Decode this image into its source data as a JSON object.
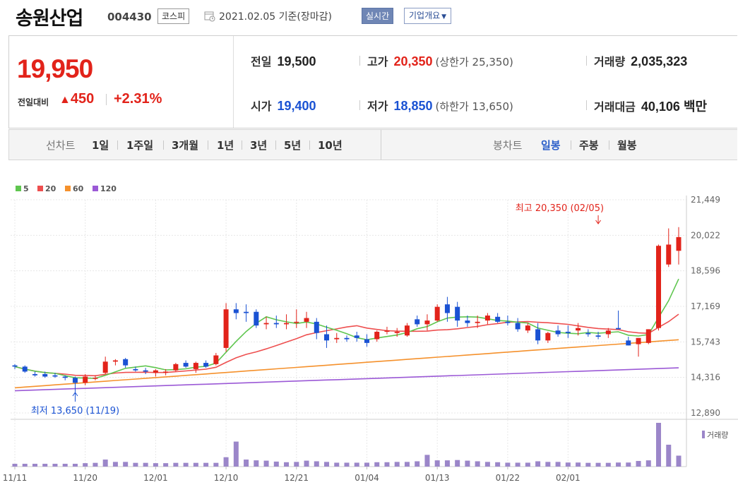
{
  "header": {
    "company": "송원산업",
    "code": "004430",
    "market": "코스피",
    "date": "2021.02.05 기준(장마감)",
    "realtime_btn": "실시간",
    "overview_btn": "기업개요"
  },
  "price": {
    "current": "19,950",
    "change_label": "전일대비",
    "change": "450",
    "change_pct": "+2.31%"
  },
  "stats": {
    "prev_label": "전일",
    "prev": "19,500",
    "open_label": "시가",
    "open": "19,400",
    "high_label": "고가",
    "high": "20,350",
    "upper_limit": "(상한가 25,350)",
    "low_label": "저가",
    "low": "18,850",
    "lower_limit": "(하한가 13,650)",
    "volume_label": "거래량",
    "volume": "2,035,323",
    "amount_label": "거래대금",
    "amount": "40,106 백만"
  },
  "periods": {
    "line_label": "선차트",
    "line": [
      "1일",
      "1주일",
      "3개월",
      "1년",
      "3년",
      "5년",
      "10년"
    ],
    "candle_label": "봉차트",
    "candle": [
      "일봉",
      "주봉",
      "월봉"
    ],
    "candle_selected": "일봉"
  },
  "colors": {
    "up": "#e2231a",
    "down": "#1a52d3",
    "ma5": "#5fc64f",
    "ma20": "#ee4f4f",
    "ma60": "#f5912c",
    "ma120": "#9b59d6",
    "volume": "#9b86c9"
  },
  "chart_data": {
    "type": "candlestick",
    "legend": [
      {
        "name": "5",
        "color": "#5fc64f"
      },
      {
        "name": "20",
        "color": "#ee4f4f"
      },
      {
        "name": "60",
        "color": "#f5912c"
      },
      {
        "name": "120",
        "color": "#9b59d6"
      }
    ],
    "y_ticks": [
      "21,449",
      "20,022",
      "18,596",
      "17,169",
      "15,743",
      "14,316",
      "12,890"
    ],
    "ylim": [
      12890,
      21449
    ],
    "x_ticks": [
      {
        "i": 0,
        "label": "11/11"
      },
      {
        "i": 7,
        "label": "11/20"
      },
      {
        "i": 14,
        "label": "12/01"
      },
      {
        "i": 21,
        "label": "12/10"
      },
      {
        "i": 28,
        "label": "12/21"
      },
      {
        "i": 35,
        "label": "01/04"
      },
      {
        "i": 42,
        "label": "01/13"
      },
      {
        "i": 49,
        "label": "01/22"
      },
      {
        "i": 55,
        "label": "02/01"
      }
    ],
    "annotations": {
      "high": {
        "i": 58,
        "text": "최고 20,350 (02/05)"
      },
      "low": {
        "i": 6,
        "text": "최저 13,650 (11/19)"
      }
    },
    "volume_label": "거래량",
    "ohlc": [
      [
        14800,
        14850,
        14650,
        14750
      ],
      [
        14750,
        14800,
        14500,
        14550
      ],
      [
        14450,
        14550,
        14350,
        14400
      ],
      [
        14450,
        14550,
        14300,
        14350
      ],
      [
        14400,
        14500,
        14300,
        14350
      ],
      [
        14350,
        14400,
        14200,
        14300
      ],
      [
        14300,
        14350,
        13650,
        14100
      ],
      [
        14100,
        14450,
        14000,
        14350
      ],
      [
        14300,
        14400,
        14200,
        14300
      ],
      [
        14500,
        15150,
        14450,
        14950
      ],
      [
        14950,
        15050,
        14800,
        15000
      ],
      [
        15050,
        15100,
        14700,
        14800
      ],
      [
        14650,
        14750,
        14550,
        14600
      ],
      [
        14600,
        14700,
        14450,
        14550
      ],
      [
        14500,
        14650,
        14350,
        14600
      ],
      [
        14550,
        14650,
        14400,
        14550
      ],
      [
        14600,
        14900,
        14550,
        14850
      ],
      [
        14900,
        15000,
        14700,
        14750
      ],
      [
        14650,
        14950,
        14500,
        14900
      ],
      [
        14900,
        15000,
        14700,
        14750
      ],
      [
        14850,
        15300,
        14800,
        15200
      ],
      [
        15500,
        17300,
        15350,
        17050
      ],
      [
        17050,
        17300,
        16650,
        16900
      ],
      [
        16950,
        17250,
        16550,
        16900
      ],
      [
        16950,
        17050,
        16300,
        16400
      ],
      [
        16450,
        16750,
        16250,
        16500
      ],
      [
        16500,
        16800,
        16300,
        16450
      ],
      [
        16450,
        16850,
        16250,
        16500
      ],
      [
        16550,
        17050,
        16300,
        16550
      ],
      [
        16550,
        16950,
        16300,
        16700
      ],
      [
        16550,
        16700,
        15850,
        16100
      ],
      [
        16050,
        16400,
        15500,
        15800
      ],
      [
        15850,
        16100,
        15700,
        15900
      ],
      [
        15900,
        16000,
        15750,
        15850
      ],
      [
        16000,
        16150,
        15750,
        15900
      ],
      [
        15850,
        16050,
        15550,
        15700
      ],
      [
        15850,
        16200,
        15750,
        16150
      ],
      [
        16150,
        16350,
        16050,
        16200
      ],
      [
        16100,
        16300,
        15950,
        16150
      ],
      [
        16000,
        16500,
        15950,
        16400
      ],
      [
        16650,
        16800,
        16350,
        16450
      ],
      [
        16450,
        16850,
        16200,
        16600
      ],
      [
        16600,
        17250,
        16550,
        17150
      ],
      [
        17250,
        17550,
        16550,
        16900
      ],
      [
        17150,
        17350,
        16350,
        16600
      ],
      [
        16600,
        16800,
        16350,
        16500
      ],
      [
        16500,
        16800,
        16300,
        16550
      ],
      [
        16600,
        16900,
        16450,
        16800
      ],
      [
        16750,
        16900,
        16500,
        16550
      ],
      [
        16550,
        16800,
        16400,
        16500
      ],
      [
        16500,
        16700,
        16150,
        16250
      ],
      [
        16200,
        16500,
        16100,
        16400
      ],
      [
        16250,
        16500,
        15650,
        15800
      ],
      [
        15800,
        16150,
        15700,
        16100
      ],
      [
        16200,
        16400,
        15950,
        16050
      ],
      [
        16150,
        16400,
        15900,
        16100
      ],
      [
        16200,
        16500,
        16000,
        16300
      ],
      [
        16100,
        16250,
        15950,
        16050
      ],
      [
        16000,
        16150,
        15850,
        15950
      ],
      [
        16050,
        16300,
        15900,
        16200
      ],
      [
        16300,
        17000,
        16250,
        16250
      ],
      [
        15800,
        15950,
        15600,
        15600
      ],
      [
        15650,
        15900,
        15150,
        15900
      ],
      [
        15700,
        16250,
        15650,
        16250
      ],
      [
        16300,
        19650,
        16200,
        19600
      ],
      [
        18850,
        20300,
        18750,
        19650
      ],
      [
        19400,
        20350,
        18850,
        19950
      ]
    ],
    "volume": [
      18,
      18,
      18,
      18,
      18,
      18,
      18,
      22,
      24,
      45,
      30,
      30,
      24,
      24,
      22,
      22,
      24,
      24,
      24,
      24,
      24,
      60,
      160,
      45,
      40,
      38,
      32,
      28,
      30,
      38,
      34,
      30,
      25,
      25,
      25,
      25,
      28,
      28,
      30,
      30,
      34,
      75,
      40,
      40,
      42,
      38,
      34,
      30,
      28,
      25,
      25,
      25,
      34,
      30,
      30,
      26,
      26,
      24,
      24,
      24,
      26,
      26,
      36,
      40,
      280,
      140,
      70
    ]
  }
}
